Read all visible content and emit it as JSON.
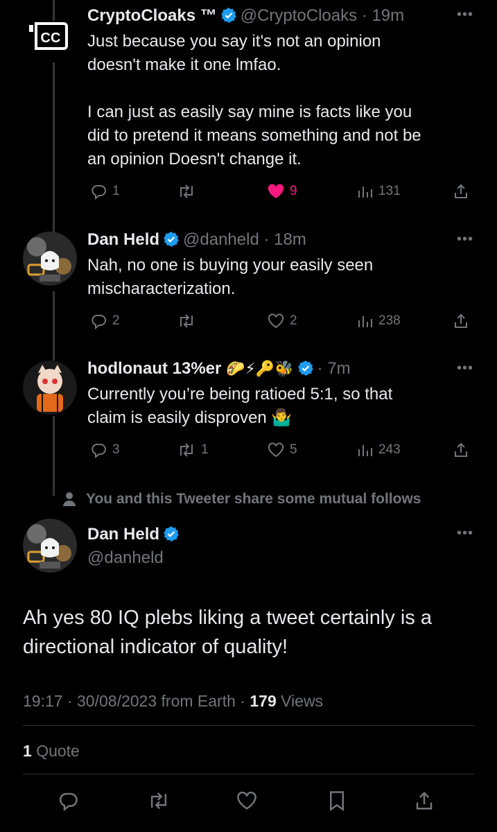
{
  "replies": [
    {
      "name": "CryptoCloaks ™",
      "handle": "@CryptoCloaks",
      "time": "19m",
      "text": "Just because you say it's not an opinion\ndoesn't make it one lmfao.\n\nI can just as easily say mine is facts like you\ndid to pretend it means something and not be\nan opinion Doesn't change it.",
      "replies": "1",
      "retweets": "",
      "likes": "9",
      "views": "131",
      "liked": true
    },
    {
      "name": "Dan Held",
      "handle": "@danheld",
      "time": "18m",
      "text": "Nah, no one is buying your easily seen\nmischaracterization.",
      "replies": "2",
      "retweets": "",
      "likes": "2",
      "views": "238",
      "liked": false
    },
    {
      "name": "hodlonaut 13%er",
      "emojis": "🌮⚡🔑🐝",
      "handle": "",
      "time": "7m",
      "text": "Currently you’re being ratioed 5:1, so that\nclaim is easily disproven 🤷‍♂️",
      "replies": "3",
      "retweets": "1",
      "likes": "5",
      "views": "243",
      "liked": false
    }
  ],
  "mutual_notice": "You and this Tweeter share some mutual follows",
  "main_tweet": {
    "name": "Dan Held",
    "handle": "@danheld",
    "text": "Ah yes 80 IQ plebs liking a tweet certainly is a\ndirectional indicator of quality!",
    "time": "19:17",
    "date": "30/08/2023",
    "source": "from Earth",
    "views_count": "179",
    "views_label": "Views",
    "quotes_count": "1",
    "quotes_label": "Quote"
  },
  "colors": {
    "background": "#000000",
    "text": "#e7e9ea",
    "muted": "#71767b",
    "like_active": "#f91880",
    "verified": "#1d9bf0"
  },
  "icons": [
    "reply-icon",
    "retweet-icon",
    "like-icon",
    "views-icon",
    "share-icon",
    "bookmark-icon",
    "verified-icon",
    "more-icon",
    "person-icon"
  ]
}
